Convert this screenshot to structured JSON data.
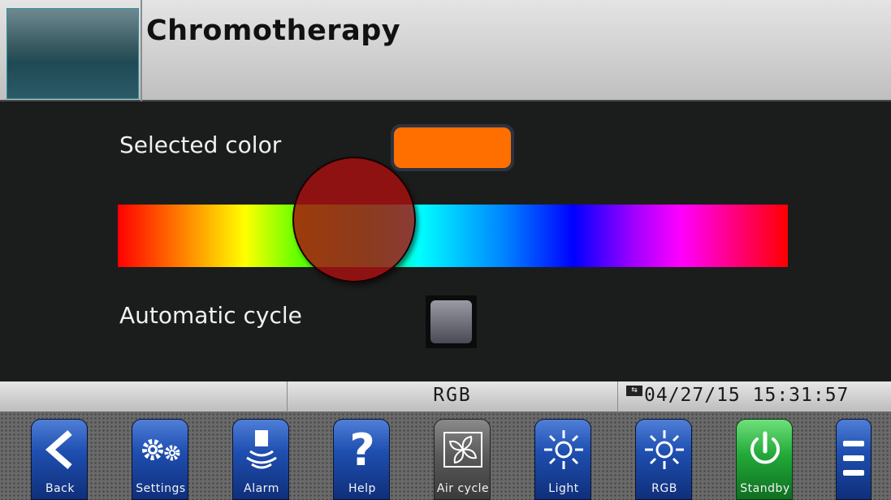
{
  "header": {
    "title": "Chromotherapy"
  },
  "main": {
    "selected_color_label": "Selected color",
    "selected_color_value": "#ff6f00",
    "automatic_cycle_label": "Automatic cycle",
    "automatic_cycle_checked": false
  },
  "status_bar": {
    "mode": "RGB",
    "datetime": "04/27/15 15:31:57"
  },
  "toolbar": {
    "buttons": [
      {
        "label": "Back",
        "icon": "back-arrow-icon"
      },
      {
        "label": "Settings",
        "icon": "gears-icon"
      },
      {
        "label": "Alarm",
        "icon": "bell-icon"
      },
      {
        "label": "Help",
        "icon": "question-icon"
      },
      {
        "label": "Air cycle",
        "icon": "fan-icon"
      },
      {
        "label": "Light",
        "icon": "sun-icon"
      },
      {
        "label": "RGB",
        "icon": "sun-icon"
      },
      {
        "label": "Standby",
        "icon": "power-icon"
      }
    ],
    "menu_icon": "hamburger-menu-icon"
  },
  "colors": {
    "accent_blue": "#1f4fb0",
    "standby_green": "#22a838",
    "knob_red": "#aa1010"
  }
}
